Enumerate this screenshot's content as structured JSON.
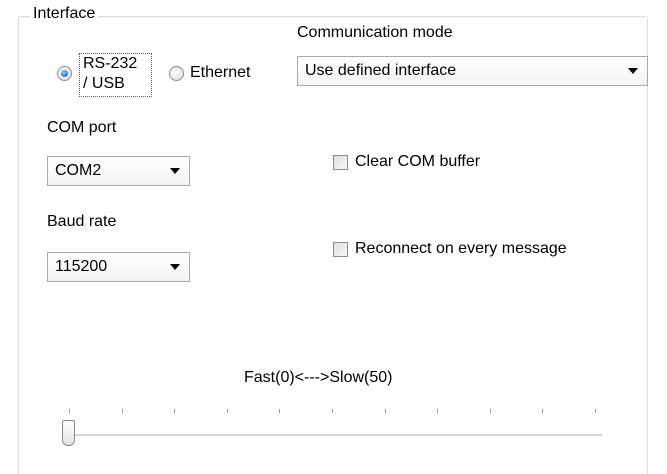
{
  "group": {
    "title": "Interface"
  },
  "interface_radios": {
    "rs232_line1": "RS-232",
    "rs232_line2": "/ USB",
    "ethernet": "Ethernet",
    "selected": "RS-232 / USB"
  },
  "communication_mode": {
    "label": "Communication mode",
    "value": "Use defined interface"
  },
  "com_port": {
    "label": "COM port",
    "value": "COM2"
  },
  "baud_rate": {
    "label": "Baud rate",
    "value": "115200"
  },
  "checkboxes": {
    "clear_buffer": {
      "label": "Clear COM buffer",
      "checked": false
    },
    "reconnect": {
      "label": "Reconnect on every message",
      "checked": false
    }
  },
  "slider": {
    "label": "Fast(0)<--->Slow(50)",
    "min": 0,
    "max": 50,
    "value": 0,
    "tick_count": 11
  },
  "colors": {
    "radio_selected": "#2a7fd0",
    "border": "#a9a9a9"
  }
}
